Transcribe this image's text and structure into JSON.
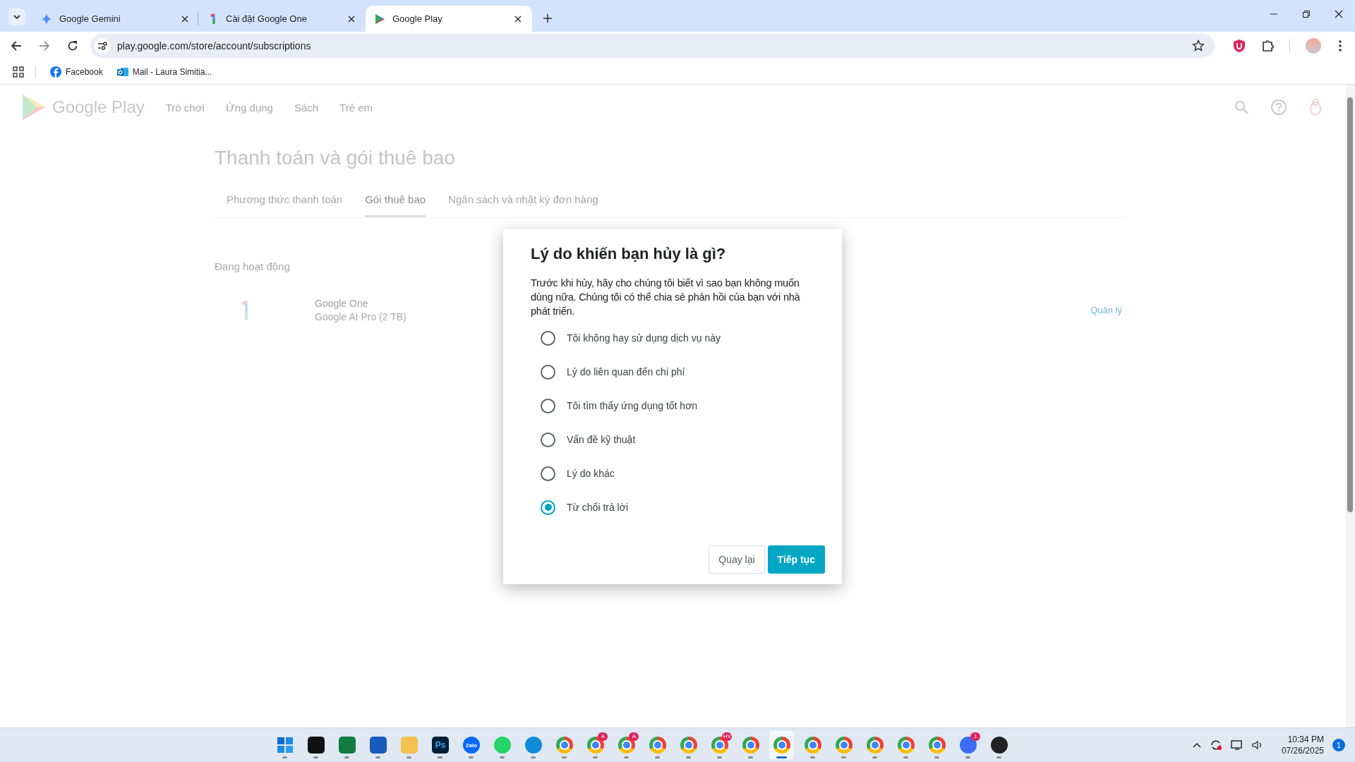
{
  "browser": {
    "tabs": [
      {
        "title": "Google Gemini",
        "kind": "gemini",
        "selected": false
      },
      {
        "title": "Cài đặt Google One",
        "kind": "one",
        "selected": false
      },
      {
        "title": "Google Play",
        "kind": "play",
        "selected": true
      }
    ],
    "address": "play.google.com/store/account/subscriptions",
    "bookmarks": [
      {
        "label": "Facebook",
        "kind": "facebook"
      },
      {
        "label": "Mail - Laura Simitia...",
        "kind": "mail"
      }
    ]
  },
  "page": {
    "brand": "Google Play",
    "nav": [
      "Trò chơi",
      "Ứng dụng",
      "Sách",
      "Trẻ em"
    ],
    "title": "Thanh toán và gói thuê bao",
    "tabs": [
      {
        "label": "Phương thức thanh toán",
        "selected": false
      },
      {
        "label": "Gói thuê bao",
        "selected": true
      },
      {
        "label": "Ngân sách và nhật ký đơn hàng",
        "selected": false
      }
    ],
    "section": "Đang hoạt động",
    "subscription": {
      "name": "Google One",
      "plan": "Google AI Pro (2 TB)",
      "action": "Quản lý"
    }
  },
  "dialog": {
    "title": "Lý do khiến bạn hủy là gì?",
    "description": "Trước khi hủy, hãy cho chúng tôi biết vì sao bạn không muốn dùng nữa. Chúng tôi có thể chia sẻ phản hồi của bạn với nhà phát triển.",
    "options": [
      {
        "label": "Tôi không hay sử dụng dịch vụ này",
        "selected": false
      },
      {
        "label": "Lý do liên quan đến chi phí",
        "selected": false
      },
      {
        "label": "Tôi tìm thấy ứng dụng tốt hơn",
        "selected": false
      },
      {
        "label": "Vấn đề kỹ thuật",
        "selected": false
      },
      {
        "label": "Lý do khác",
        "selected": false
      },
      {
        "label": "Từ chối trả lời",
        "selected": true
      }
    ],
    "buttons": [
      {
        "label": "Quay lại",
        "kind": "secondary"
      },
      {
        "label": "Tiếp tục",
        "kind": "primary"
      }
    ]
  },
  "taskbar": {
    "apps": [
      {
        "kind": "start",
        "selected": false
      },
      {
        "kind": "capcut",
        "selected": false
      },
      {
        "kind": "excel",
        "selected": false
      },
      {
        "kind": "word",
        "selected": false
      },
      {
        "kind": "folder",
        "selected": false
      },
      {
        "kind": "photoshop",
        "label": "Ps",
        "selected": false
      },
      {
        "kind": "zalo",
        "label": "Zalo",
        "selected": false
      },
      {
        "kind": "whatsapp",
        "selected": false
      },
      {
        "kind": "edge",
        "selected": false
      },
      {
        "kind": "chrome",
        "selected": false
      },
      {
        "kind": "chrome",
        "badge": "A",
        "selected": false
      },
      {
        "kind": "chrome",
        "badge": "A",
        "selected": false
      },
      {
        "kind": "chrome",
        "selected": false
      },
      {
        "kind": "chrome",
        "selected": false
      },
      {
        "kind": "chrome",
        "badge": "HV",
        "selected": false
      },
      {
        "kind": "chrome",
        "selected": false
      },
      {
        "kind": "chrome",
        "selected": true
      },
      {
        "kind": "chrome",
        "selected": false
      },
      {
        "kind": "chrome",
        "selected": false
      },
      {
        "kind": "chrome",
        "selected": false
      },
      {
        "kind": "chrome",
        "selected": false
      },
      {
        "kind": "chrome",
        "selected": false
      },
      {
        "kind": "copilot",
        "badge": "1",
        "selected": false
      },
      {
        "kind": "obs",
        "selected": false
      }
    ],
    "time": "10:34 PM",
    "date": "07/26/2025",
    "notifications": "1"
  }
}
